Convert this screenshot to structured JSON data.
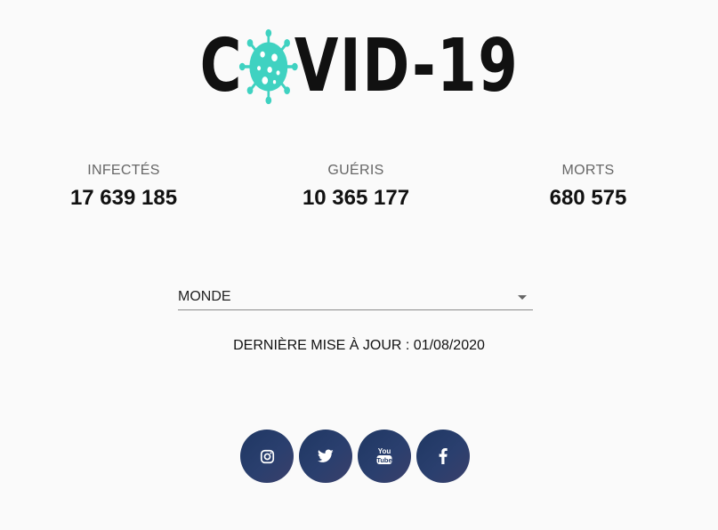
{
  "logo": {
    "text_before": "C",
    "text_after": "VID-19",
    "virus_color": "#3fd2c1"
  },
  "stats": {
    "infected": {
      "label": "INFECTÉS",
      "value": "17 639 185"
    },
    "recovered": {
      "label": "GUÉRIS",
      "value": "10 365 177"
    },
    "deaths": {
      "label": "MORTS",
      "value": "680 575"
    }
  },
  "region_select": {
    "value": "MONDE"
  },
  "last_update": {
    "text": "DERNIÈRE MISE À JOUR : 01/08/2020"
  },
  "socials": {
    "color": "#233a67",
    "items": [
      "instagram-icon",
      "twitter-icon",
      "youtube-icon",
      "facebook-icon"
    ],
    "youtube_label_top": "You",
    "youtube_label_bottom": "Tube"
  }
}
